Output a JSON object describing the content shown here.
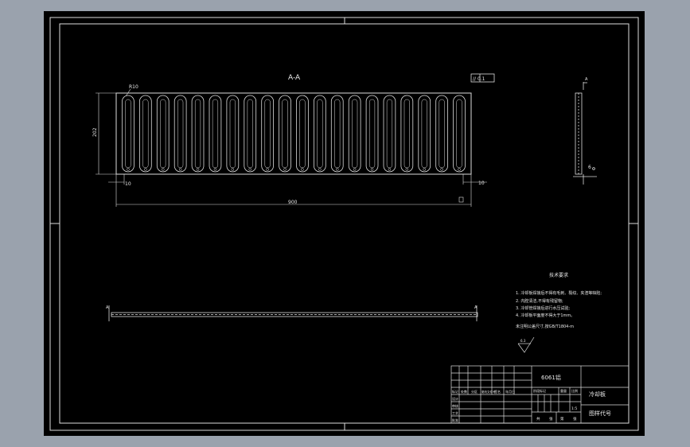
{
  "drawing": {
    "section_label": "A-A",
    "flatness_tolerance": "// 0.1",
    "radius_note": "R10",
    "height_dim": "202",
    "left_offset_dim": "10",
    "right_offset_dim": "10",
    "width_dim": "900",
    "channel_count": 20,
    "section_marker_top": "A",
    "section_marker_bottom": "A",
    "side_view_note": "6",
    "roughness_mark": "6.3"
  },
  "tech_requirements": {
    "title": "技术要求",
    "items": [
      "1. 冷却板焊接后不得有毛刺、裂纹、夹渣等缺陷;",
      "2. 内腔清洁,不得有残留物;",
      "3. 冷却管焊接后进行水压试验;",
      "4. 冷却板平面度不得大于1mm。"
    ],
    "note": "未注明公差尺寸,按GB/T1804-m"
  },
  "title_block": {
    "material": "6061铝",
    "part_name": "冷却板",
    "drawing_number": "图样代号",
    "scale": "1:5",
    "headers": [
      "标记",
      "处数",
      "分区",
      "更改文件号",
      "签名",
      "年月日"
    ],
    "roles": [
      "设计",
      "审核",
      "工艺",
      "批准"
    ],
    "stage_labels": [
      "阶段标记",
      "重量",
      "比例"
    ],
    "sheet_labels": [
      "共",
      "张",
      "第",
      "张"
    ]
  }
}
